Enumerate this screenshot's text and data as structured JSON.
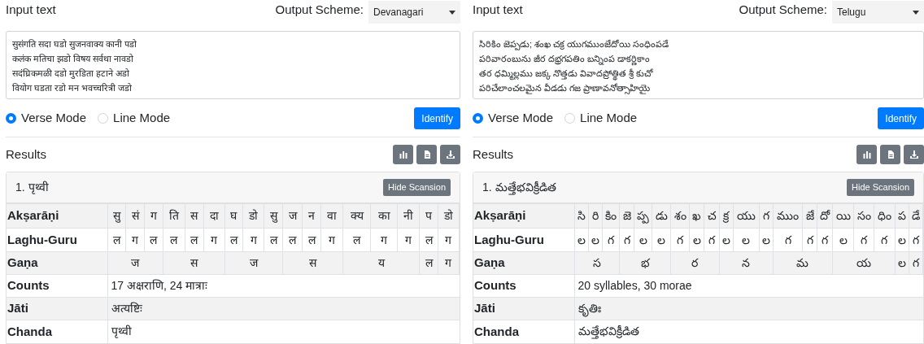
{
  "panels": [
    {
      "input_label": "Input text",
      "output_scheme_label": "Output Scheme:",
      "output_scheme": "Devanagari",
      "input_text": "सुसंगति सदा घडो सुजनवाक्य कानी पडो\nकलंक मतिचा झडो विषय सर्वथा नावडो\nसदंघ्रिकमळी दडो मुरडिता हटाने अडो\nवियोग घडता रडो मन भवच्चरित्री जडो",
      "modes": [
        {
          "label": "Verse Mode",
          "selected": true
        },
        {
          "label": "Line Mode",
          "selected": false
        }
      ],
      "identify": "Identify",
      "results_label": "Results",
      "result_title": "1. पृथ्वी",
      "hide_button": "Hide Scansion",
      "aksharani": {
        "label": "Akṣarāṇi",
        "cells": [
          "सु",
          "सं",
          "ग",
          "ति",
          "स",
          "दा",
          "घ",
          "डो",
          "सु",
          "ज",
          "न",
          "वा",
          "क्य",
          "का",
          "नी",
          "प",
          "डो"
        ]
      },
      "laghu_guru": {
        "label": "Laghu-Guru",
        "cells": [
          "ल",
          "ग",
          "ल",
          "ल",
          "ल",
          "ग",
          "ल",
          "ग",
          "ल",
          "ल",
          "ल",
          "ग",
          "ल",
          "ग",
          "ग",
          "ल",
          "ग"
        ]
      },
      "gana": {
        "label": "Gaṇa",
        "cells": [
          {
            "text": "ज",
            "kind": "triple"
          },
          {
            "text": "स",
            "kind": "triple"
          },
          {
            "text": "ज",
            "kind": "triple"
          },
          {
            "text": "स",
            "kind": "triple"
          },
          {
            "text": "य",
            "kind": "triple"
          },
          {
            "text": "ल",
            "kind": "single"
          },
          {
            "text": "ग",
            "kind": "single"
          }
        ]
      },
      "info": [
        {
          "label": "Counts",
          "value": "17 अक्षराणि, 24 मात्राः"
        },
        {
          "label": "Jāti",
          "value": "अत्यष्टिः"
        },
        {
          "label": "Chanda",
          "value": "पृथ्वी"
        }
      ]
    },
    {
      "input_label": "Input text",
      "output_scheme_label": "Output Scheme:",
      "output_scheme": "Telugu",
      "input_text": "సిరికిం జెప్పడు; శంఖ చక్ర యుగముంజేదోయి సంధింపడే\nపరివారంబును జీర దభ్రగపతిం బన్నింప డాకర్ణికాం\nతర ధమ్మిల్లము జక్క నొత్తడు వివాదప్రోత్థిత శ్రీ కుచో\nపరిచేలాంచలమైన వీడడు గజ ప్రాణావనోత్సాహియై",
      "modes": [
        {
          "label": "Verse Mode",
          "selected": true
        },
        {
          "label": "Line Mode",
          "selected": false
        }
      ],
      "identify": "Identify",
      "results_label": "Results",
      "result_title": "1. మత్తేభవిక్రీడిత",
      "hide_button": "Hide Scansion",
      "aksharani": {
        "label": "Akṣarāṇi",
        "cells": [
          "సి",
          "రి",
          "కిం",
          "జె",
          "ప్ప",
          "డు",
          "శం",
          "ఖ",
          "చ",
          "క్ర",
          "యు",
          "గ",
          "ముం",
          "జే",
          "దో",
          "యి",
          "సం",
          "ధిం",
          "ప",
          "డే"
        ]
      },
      "laghu_guru": {
        "label": "Laghu-Guru",
        "cells": [
          "ల",
          "ల",
          "గ",
          "గ",
          "ల",
          "ల",
          "గ",
          "ల",
          "గ",
          "ల",
          "ల",
          "ల",
          "గ",
          "గ",
          "గ",
          "ల",
          "గ",
          "గ",
          "ల",
          "గ"
        ]
      },
      "gana": {
        "label": "Gaṇa",
        "cells": [
          {
            "text": "స",
            "kind": "triple"
          },
          {
            "text": "భ",
            "kind": "triple"
          },
          {
            "text": "ర",
            "kind": "triple"
          },
          {
            "text": "న",
            "kind": "triple"
          },
          {
            "text": "మ",
            "kind": "triple"
          },
          {
            "text": "య",
            "kind": "triple"
          },
          {
            "text": "ల",
            "kind": "single"
          },
          {
            "text": "గ",
            "kind": "single"
          }
        ]
      },
      "info": [
        {
          "label": "Counts",
          "value": "20 syllables, 30 morae"
        },
        {
          "label": "Jāti",
          "value": "కృతిః"
        },
        {
          "label": "Chanda",
          "value": "మత్తేభవిక్రీడిత"
        }
      ]
    }
  ]
}
